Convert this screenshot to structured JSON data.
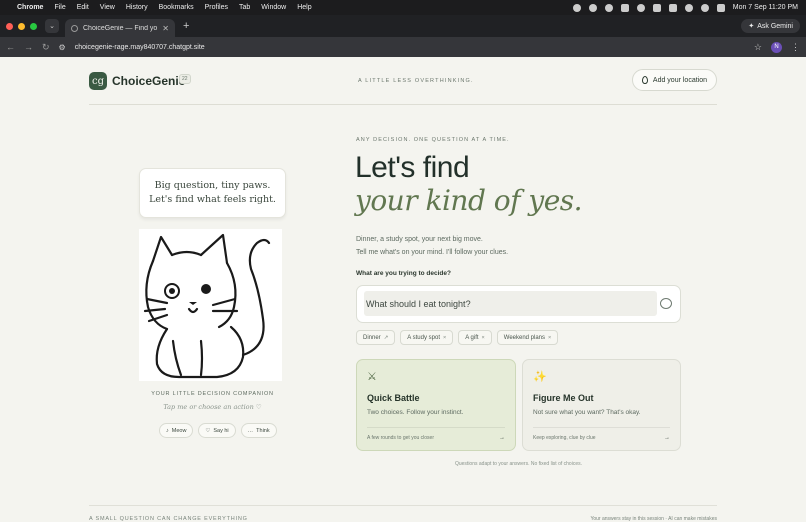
{
  "menubar": {
    "app": "Chrome",
    "items": [
      "File",
      "Edit",
      "View",
      "History",
      "Bookmarks",
      "Profiles",
      "Tab",
      "Window",
      "Help"
    ],
    "datetime": "Mon 7 Sep  11:20 PM"
  },
  "browser": {
    "tab_title": "ChoiceGenie — Find your cl...",
    "url": "choicegenie-rage.may840707.chatgpt.site",
    "ask_gemini": "Ask Gemini",
    "profile_initial": "N"
  },
  "header": {
    "brand": "ChoiceGenie",
    "logo_mark": "cg",
    "badge": "22",
    "tagline": "A LITTLE LESS OVERTHINKING.",
    "location_button": "Add your location"
  },
  "companion": {
    "bubble_line1": "Big question, tiny paws.",
    "bubble_line2": "Let's find what feels right.",
    "label": "YOUR LITTLE DECISION COMPANION",
    "hint": "Tap me or choose an action ♡",
    "actions": [
      {
        "icon": "♪",
        "label": "Meow"
      },
      {
        "icon": "♡",
        "label": "Say hi"
      },
      {
        "icon": "…",
        "label": "Think"
      }
    ]
  },
  "hero": {
    "eyebrow": "ANY DECISION. ONE QUESTION AT A TIME.",
    "line1": "Let's find",
    "line2": "your kind of yes.",
    "sub1": "Dinner, a study spot, your next big move.",
    "sub2": "Tell me what's on your mind. I'll follow your clues."
  },
  "question": {
    "label": "What are you trying to decide?",
    "value": "What should I eat tonight?"
  },
  "chips": [
    {
      "label": "Dinner",
      "mark": "↗"
    },
    {
      "label": "A study spot",
      "mark": "×"
    },
    {
      "label": "A gift",
      "mark": "×"
    },
    {
      "label": "Weekend plans",
      "mark": "×"
    }
  ],
  "cards": {
    "battle": {
      "title": "Quick Battle",
      "desc": "Two choices. Follow your instinct.",
      "foot": "A few rounds to get you closer",
      "arrow": "→"
    },
    "figure": {
      "title": "Figure Me Out",
      "desc": "Not sure what you want? That's okay.",
      "foot": "Keep exploring, clue by clue",
      "arrow": "→"
    }
  },
  "note": "Questions adapt to your answers. No fixed list of choices.",
  "footer": {
    "left": "A SMALL QUESTION CAN CHANGE EVERYTHING",
    "right": "Your answers stay in this session · AI can make mistakes"
  },
  "colors": {
    "accent_green": "#617750",
    "card_green": "#e6ecd8",
    "logo_bg": "#3a5a43"
  }
}
